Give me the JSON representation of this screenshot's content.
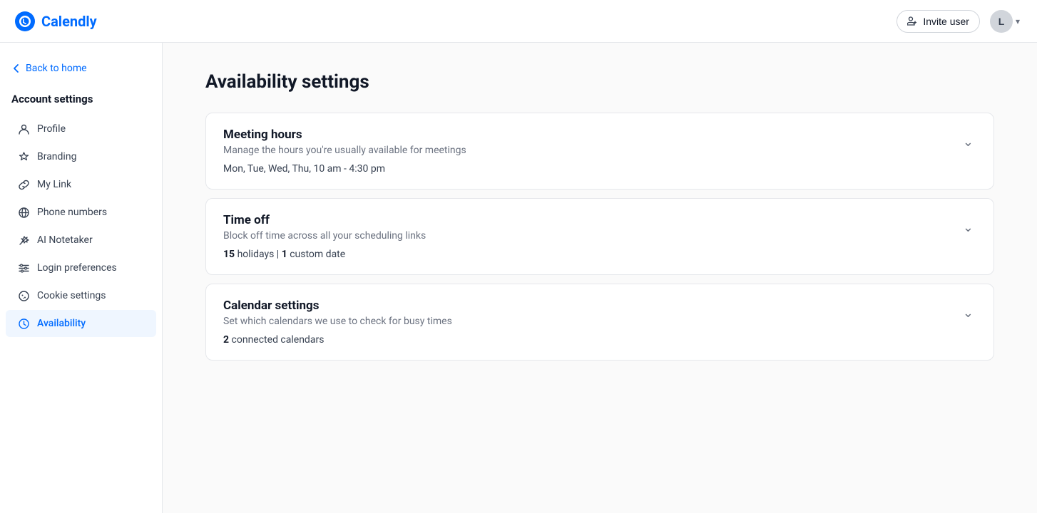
{
  "header": {
    "logo_text": "Calendly",
    "invite_label": "Invite user",
    "user_initial": "L"
  },
  "sidebar": {
    "back_label": "Back to home",
    "section_label": "Account settings",
    "nav_items": [
      {
        "id": "profile",
        "label": "Profile",
        "icon": "person"
      },
      {
        "id": "branding",
        "label": "Branding",
        "icon": "star"
      },
      {
        "id": "my-link",
        "label": "My Link",
        "icon": "link"
      },
      {
        "id": "phone-numbers",
        "label": "Phone numbers",
        "icon": "globe"
      },
      {
        "id": "ai-notetaker",
        "label": "AI Notetaker",
        "icon": "wand"
      },
      {
        "id": "login-preferences",
        "label": "Login preferences",
        "icon": "sliders"
      },
      {
        "id": "cookie-settings",
        "label": "Cookie settings",
        "icon": "cookie"
      },
      {
        "id": "availability",
        "label": "Availability",
        "icon": "clock",
        "active": true
      }
    ]
  },
  "main": {
    "page_title": "Availability settings",
    "cards": [
      {
        "id": "meeting-hours",
        "title": "Meeting hours",
        "description": "Manage the hours you're usually available for meetings",
        "detail": "Mon, Tue, Wed, Thu, 10 am - 4:30 pm"
      },
      {
        "id": "time-off",
        "title": "Time off",
        "description": "Block off time across all your scheduling links",
        "detail_prefix": "15",
        "detail_prefix_label": " holidays | ",
        "detail_highlight": "1",
        "detail_suffix": " custom date"
      },
      {
        "id": "calendar-settings",
        "title": "Calendar settings",
        "description": "Set which calendars we use to check for busy times",
        "detail_prefix": "2",
        "detail_suffix": " connected calendars"
      }
    ]
  }
}
